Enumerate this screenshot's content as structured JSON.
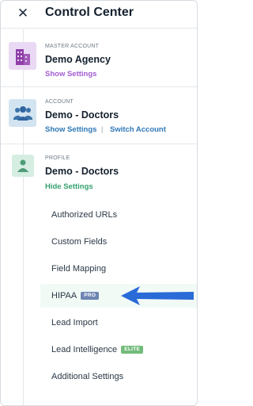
{
  "header": {
    "close_icon": "close-icon",
    "title": "Control Center"
  },
  "master_account": {
    "icon": "building-icon",
    "label": "MASTER ACCOUNT",
    "name": "Demo Agency",
    "show_settings": "Show Settings"
  },
  "account": {
    "icon": "users-group-icon",
    "label": "ACCOUNT",
    "name": "Demo - Doctors",
    "show_settings": "Show Settings",
    "separator": "|",
    "switch_account": "Switch Account"
  },
  "profile": {
    "icon": "user-icon",
    "label": "PROFILE",
    "name": "Demo - Doctors",
    "hide_settings": "Hide Settings"
  },
  "menu": {
    "items": [
      {
        "label": "Authorized URLs",
        "badge": ""
      },
      {
        "label": "Custom Fields",
        "badge": ""
      },
      {
        "label": "Field Mapping",
        "badge": ""
      },
      {
        "label": "HIPAA",
        "badge": "PRO"
      },
      {
        "label": "Lead Import",
        "badge": ""
      },
      {
        "label": "Lead Intelligence",
        "badge": "ELITE"
      },
      {
        "label": "Additional Settings",
        "badge": ""
      }
    ],
    "highlighted": "HIPAA"
  },
  "colors": {
    "purple_link": "#a25dd1",
    "blue_link": "#2f78b8",
    "green_link": "#35a06f",
    "pro_badge": "#6f86b3",
    "elite_badge": "#72bb7b",
    "arrow": "#2a6bd8"
  },
  "annotation": {
    "arrow_icon": "left-arrow-icon"
  }
}
